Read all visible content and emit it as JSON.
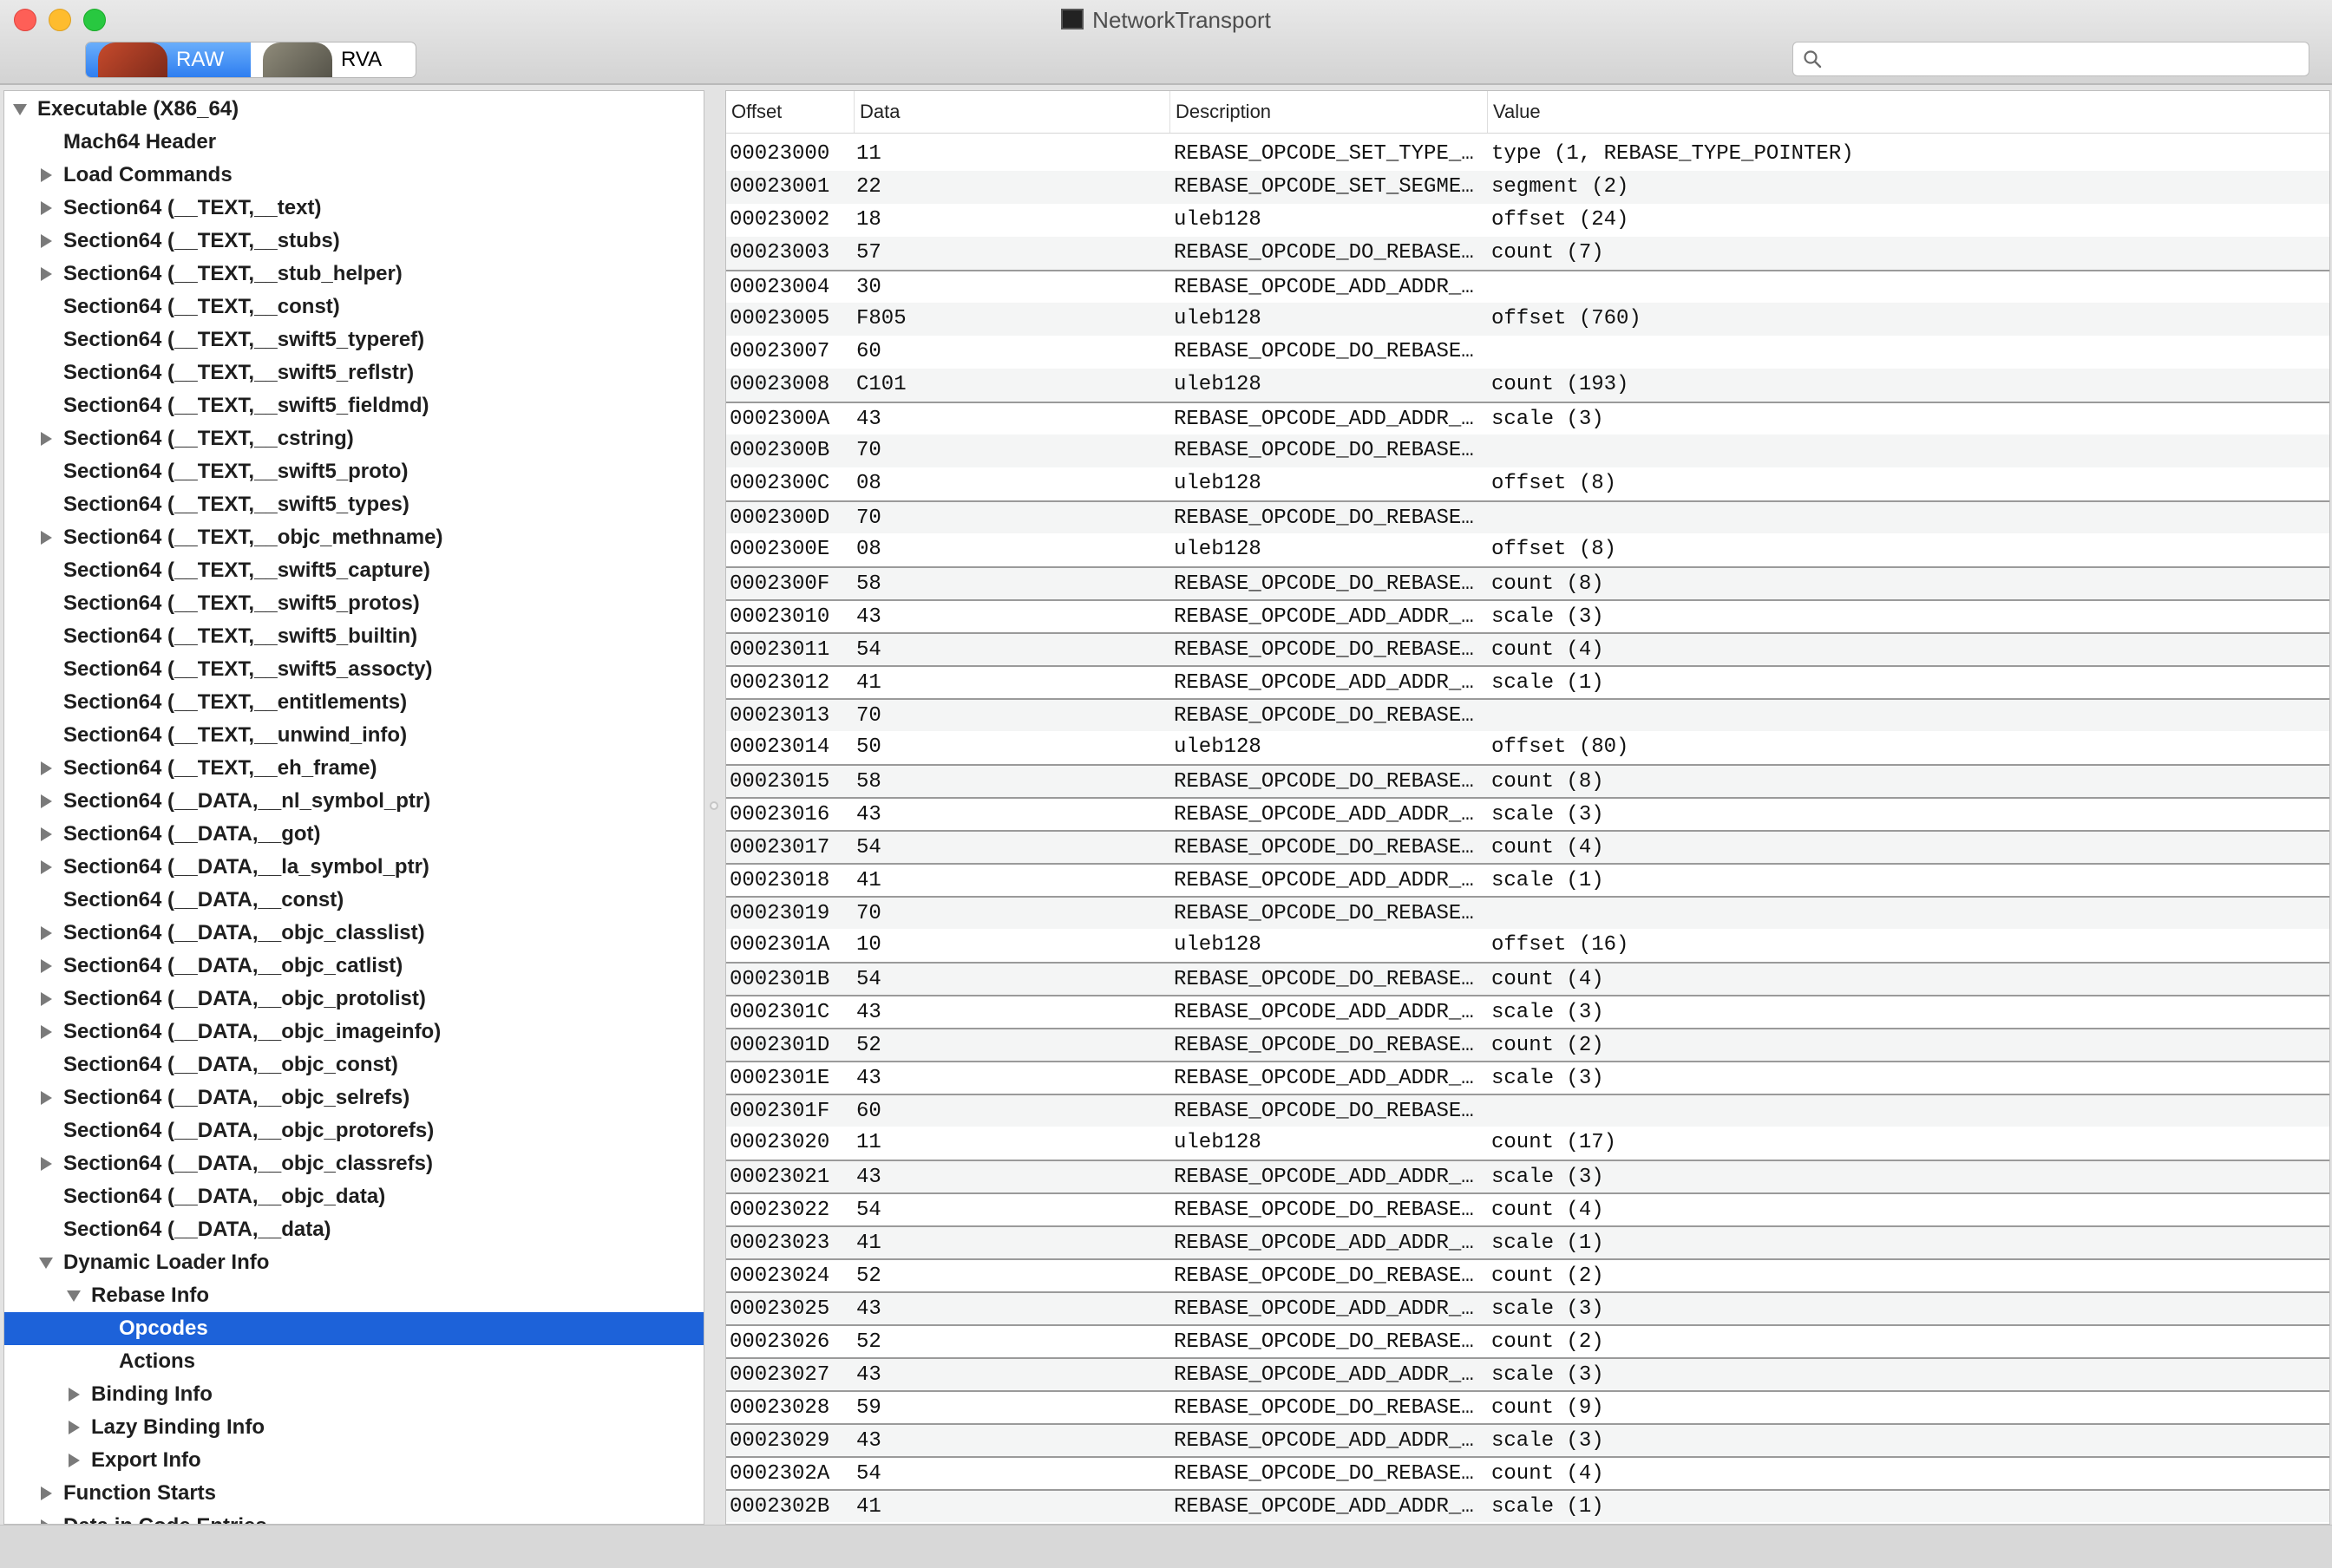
{
  "window": {
    "title": "NetworkTransport"
  },
  "toolbar": {
    "raw_label": "RAW",
    "rva_label": "RVA",
    "search_placeholder": "",
    "search_value": ""
  },
  "sidebar": {
    "items": [
      {
        "label": "Executable  (X86_64)",
        "indent": 0,
        "disclosure": "open",
        "selected": false
      },
      {
        "label": "Mach64 Header",
        "indent": 1,
        "disclosure": "none",
        "selected": false
      },
      {
        "label": "Load Commands",
        "indent": 1,
        "disclosure": "closed",
        "selected": false
      },
      {
        "label": "Section64 (__TEXT,__text)",
        "indent": 1,
        "disclosure": "closed",
        "selected": false
      },
      {
        "label": "Section64 (__TEXT,__stubs)",
        "indent": 1,
        "disclosure": "closed",
        "selected": false
      },
      {
        "label": "Section64 (__TEXT,__stub_helper)",
        "indent": 1,
        "disclosure": "closed",
        "selected": false
      },
      {
        "label": "Section64 (__TEXT,__const)",
        "indent": 1,
        "disclosure": "none",
        "selected": false
      },
      {
        "label": "Section64 (__TEXT,__swift5_typeref)",
        "indent": 1,
        "disclosure": "none",
        "selected": false
      },
      {
        "label": "Section64 (__TEXT,__swift5_reflstr)",
        "indent": 1,
        "disclosure": "none",
        "selected": false
      },
      {
        "label": "Section64 (__TEXT,__swift5_fieldmd)",
        "indent": 1,
        "disclosure": "none",
        "selected": false
      },
      {
        "label": "Section64 (__TEXT,__cstring)",
        "indent": 1,
        "disclosure": "closed",
        "selected": false
      },
      {
        "label": "Section64 (__TEXT,__swift5_proto)",
        "indent": 1,
        "disclosure": "none",
        "selected": false
      },
      {
        "label": "Section64 (__TEXT,__swift5_types)",
        "indent": 1,
        "disclosure": "none",
        "selected": false
      },
      {
        "label": "Section64 (__TEXT,__objc_methname)",
        "indent": 1,
        "disclosure": "closed",
        "selected": false
      },
      {
        "label": "Section64 (__TEXT,__swift5_capture)",
        "indent": 1,
        "disclosure": "none",
        "selected": false
      },
      {
        "label": "Section64 (__TEXT,__swift5_protos)",
        "indent": 1,
        "disclosure": "none",
        "selected": false
      },
      {
        "label": "Section64 (__TEXT,__swift5_builtin)",
        "indent": 1,
        "disclosure": "none",
        "selected": false
      },
      {
        "label": "Section64 (__TEXT,__swift5_assocty)",
        "indent": 1,
        "disclosure": "none",
        "selected": false
      },
      {
        "label": "Section64 (__TEXT,__entitlements)",
        "indent": 1,
        "disclosure": "none",
        "selected": false
      },
      {
        "label": "Section64 (__TEXT,__unwind_info)",
        "indent": 1,
        "disclosure": "none",
        "selected": false
      },
      {
        "label": "Section64 (__TEXT,__eh_frame)",
        "indent": 1,
        "disclosure": "closed",
        "selected": false
      },
      {
        "label": "Section64 (__DATA,__nl_symbol_ptr)",
        "indent": 1,
        "disclosure": "closed",
        "selected": false
      },
      {
        "label": "Section64 (__DATA,__got)",
        "indent": 1,
        "disclosure": "closed",
        "selected": false
      },
      {
        "label": "Section64 (__DATA,__la_symbol_ptr)",
        "indent": 1,
        "disclosure": "closed",
        "selected": false
      },
      {
        "label": "Section64 (__DATA,__const)",
        "indent": 1,
        "disclosure": "none",
        "selected": false
      },
      {
        "label": "Section64 (__DATA,__objc_classlist)",
        "indent": 1,
        "disclosure": "closed",
        "selected": false
      },
      {
        "label": "Section64 (__DATA,__objc_catlist)",
        "indent": 1,
        "disclosure": "closed",
        "selected": false
      },
      {
        "label": "Section64 (__DATA,__objc_protolist)",
        "indent": 1,
        "disclosure": "closed",
        "selected": false
      },
      {
        "label": "Section64 (__DATA,__objc_imageinfo)",
        "indent": 1,
        "disclosure": "closed",
        "selected": false
      },
      {
        "label": "Section64 (__DATA,__objc_const)",
        "indent": 1,
        "disclosure": "none",
        "selected": false
      },
      {
        "label": "Section64 (__DATA,__objc_selrefs)",
        "indent": 1,
        "disclosure": "closed",
        "selected": false
      },
      {
        "label": "Section64 (__DATA,__objc_protorefs)",
        "indent": 1,
        "disclosure": "none",
        "selected": false
      },
      {
        "label": "Section64 (__DATA,__objc_classrefs)",
        "indent": 1,
        "disclosure": "closed",
        "selected": false
      },
      {
        "label": "Section64 (__DATA,__objc_data)",
        "indent": 1,
        "disclosure": "none",
        "selected": false
      },
      {
        "label": "Section64 (__DATA,__data)",
        "indent": 1,
        "disclosure": "none",
        "selected": false
      },
      {
        "label": "Dynamic Loader Info",
        "indent": 1,
        "disclosure": "open",
        "selected": false
      },
      {
        "label": "Rebase Info",
        "indent": 2,
        "disclosure": "open",
        "selected": false
      },
      {
        "label": "Opcodes",
        "indent": 3,
        "disclosure": "none",
        "selected": true
      },
      {
        "label": "Actions",
        "indent": 3,
        "disclosure": "none",
        "selected": false
      },
      {
        "label": "Binding Info",
        "indent": 2,
        "disclosure": "closed",
        "selected": false
      },
      {
        "label": "Lazy Binding Info",
        "indent": 2,
        "disclosure": "closed",
        "selected": false
      },
      {
        "label": "Export Info",
        "indent": 2,
        "disclosure": "closed",
        "selected": false
      },
      {
        "label": "Function Starts",
        "indent": 1,
        "disclosure": "closed",
        "selected": false
      },
      {
        "label": "Data in Code Entries",
        "indent": 1,
        "disclosure": "closed",
        "selected": false
      }
    ]
  },
  "table": {
    "columns": [
      "Offset",
      "Data",
      "Description",
      "Value"
    ],
    "rows": [
      {
        "offset": "00023000",
        "data": "11",
        "description": "REBASE_OPCODE_SET_TYPE_IMM",
        "value": "type (1, REBASE_TYPE_POINTER)",
        "group_start": false
      },
      {
        "offset": "00023001",
        "data": "22",
        "description": "REBASE_OPCODE_SET_SEGMENT_AND_OFFSET_ULEB",
        "value": "segment (2)",
        "group_start": false
      },
      {
        "offset": "00023002",
        "data": "18",
        "description": "uleb128",
        "value": "offset (24)",
        "group_start": false
      },
      {
        "offset": "00023003",
        "data": "57",
        "description": "REBASE_OPCODE_DO_REBASE_IMM_TIMES",
        "value": "count (7)",
        "group_start": false
      },
      {
        "offset": "00023004",
        "data": "30",
        "description": "REBASE_OPCODE_ADD_ADDR_ULEB",
        "value": "",
        "group_start": true
      },
      {
        "offset": "00023005",
        "data": "F805",
        "description": "uleb128",
        "value": "offset (760)",
        "group_start": false
      },
      {
        "offset": "00023007",
        "data": "60",
        "description": "REBASE_OPCODE_DO_REBASE_ULEB_TIMES",
        "value": "",
        "group_start": false
      },
      {
        "offset": "00023008",
        "data": "C101",
        "description": "uleb128",
        "value": "count (193)",
        "group_start": false
      },
      {
        "offset": "0002300A",
        "data": "43",
        "description": "REBASE_OPCODE_ADD_ADDR_IMM_SCALED",
        "value": "scale (3)",
        "group_start": true
      },
      {
        "offset": "0002300B",
        "data": "70",
        "description": "REBASE_OPCODE_DO_REBASE_ADD_ADDR_ULEB",
        "value": "",
        "group_start": false
      },
      {
        "offset": "0002300C",
        "data": "08",
        "description": "uleb128",
        "value": "offset (8)",
        "group_start": false
      },
      {
        "offset": "0002300D",
        "data": "70",
        "description": "REBASE_OPCODE_DO_REBASE_ADD_ADDR_ULEB",
        "value": "",
        "group_start": true
      },
      {
        "offset": "0002300E",
        "data": "08",
        "description": "uleb128",
        "value": "offset (8)",
        "group_start": false
      },
      {
        "offset": "0002300F",
        "data": "58",
        "description": "REBASE_OPCODE_DO_REBASE_IMM_TIMES",
        "value": "count (8)",
        "group_start": true
      },
      {
        "offset": "00023010",
        "data": "43",
        "description": "REBASE_OPCODE_ADD_ADDR_IMM_SCALED",
        "value": "scale (3)",
        "group_start": true
      },
      {
        "offset": "00023011",
        "data": "54",
        "description": "REBASE_OPCODE_DO_REBASE_IMM_TIMES",
        "value": "count (4)",
        "group_start": true
      },
      {
        "offset": "00023012",
        "data": "41",
        "description": "REBASE_OPCODE_ADD_ADDR_IMM_SCALED",
        "value": "scale (1)",
        "group_start": true
      },
      {
        "offset": "00023013",
        "data": "70",
        "description": "REBASE_OPCODE_DO_REBASE_ADD_ADDR_ULEB",
        "value": "",
        "group_start": true
      },
      {
        "offset": "00023014",
        "data": "50",
        "description": "uleb128",
        "value": "offset (80)",
        "group_start": false
      },
      {
        "offset": "00023015",
        "data": "58",
        "description": "REBASE_OPCODE_DO_REBASE_IMM_TIMES",
        "value": "count (8)",
        "group_start": true
      },
      {
        "offset": "00023016",
        "data": "43",
        "description": "REBASE_OPCODE_ADD_ADDR_IMM_SCALED",
        "value": "scale (3)",
        "group_start": true
      },
      {
        "offset": "00023017",
        "data": "54",
        "description": "REBASE_OPCODE_DO_REBASE_IMM_TIMES",
        "value": "count (4)",
        "group_start": true
      },
      {
        "offset": "00023018",
        "data": "41",
        "description": "REBASE_OPCODE_ADD_ADDR_IMM_SCALED",
        "value": "scale (1)",
        "group_start": true
      },
      {
        "offset": "00023019",
        "data": "70",
        "description": "REBASE_OPCODE_DO_REBASE_ADD_ADDR_ULEB",
        "value": "",
        "group_start": true
      },
      {
        "offset": "0002301A",
        "data": "10",
        "description": "uleb128",
        "value": "offset (16)",
        "group_start": false
      },
      {
        "offset": "0002301B",
        "data": "54",
        "description": "REBASE_OPCODE_DO_REBASE_IMM_TIMES",
        "value": "count (4)",
        "group_start": true
      },
      {
        "offset": "0002301C",
        "data": "43",
        "description": "REBASE_OPCODE_ADD_ADDR_IMM_SCALED",
        "value": "scale (3)",
        "group_start": true
      },
      {
        "offset": "0002301D",
        "data": "52",
        "description": "REBASE_OPCODE_DO_REBASE_IMM_TIMES",
        "value": "count (2)",
        "group_start": true
      },
      {
        "offset": "0002301E",
        "data": "43",
        "description": "REBASE_OPCODE_ADD_ADDR_IMM_SCALED",
        "value": "scale (3)",
        "group_start": true
      },
      {
        "offset": "0002301F",
        "data": "60",
        "description": "REBASE_OPCODE_DO_REBASE_ULEB_TIMES",
        "value": "",
        "group_start": true
      },
      {
        "offset": "00023020",
        "data": "11",
        "description": "uleb128",
        "value": "count (17)",
        "group_start": false
      },
      {
        "offset": "00023021",
        "data": "43",
        "description": "REBASE_OPCODE_ADD_ADDR_IMM_SCALED",
        "value": "scale (3)",
        "group_start": true
      },
      {
        "offset": "00023022",
        "data": "54",
        "description": "REBASE_OPCODE_DO_REBASE_IMM_TIMES",
        "value": "count (4)",
        "group_start": true
      },
      {
        "offset": "00023023",
        "data": "41",
        "description": "REBASE_OPCODE_ADD_ADDR_IMM_SCALED",
        "value": "scale (1)",
        "group_start": true
      },
      {
        "offset": "00023024",
        "data": "52",
        "description": "REBASE_OPCODE_DO_REBASE_IMM_TIMES",
        "value": "count (2)",
        "group_start": true
      },
      {
        "offset": "00023025",
        "data": "43",
        "description": "REBASE_OPCODE_ADD_ADDR_IMM_SCALED",
        "value": "scale (3)",
        "group_start": true
      },
      {
        "offset": "00023026",
        "data": "52",
        "description": "REBASE_OPCODE_DO_REBASE_IMM_TIMES",
        "value": "count (2)",
        "group_start": true
      },
      {
        "offset": "00023027",
        "data": "43",
        "description": "REBASE_OPCODE_ADD_ADDR_IMM_SCALED",
        "value": "scale (3)",
        "group_start": true
      },
      {
        "offset": "00023028",
        "data": "59",
        "description": "REBASE_OPCODE_DO_REBASE_IMM_TIMES",
        "value": "count (9)",
        "group_start": true
      },
      {
        "offset": "00023029",
        "data": "43",
        "description": "REBASE_OPCODE_ADD_ADDR_IMM_SCALED",
        "value": "scale (3)",
        "group_start": true
      },
      {
        "offset": "0002302A",
        "data": "54",
        "description": "REBASE_OPCODE_DO_REBASE_IMM_TIMES",
        "value": "count (4)",
        "group_start": true
      },
      {
        "offset": "0002302B",
        "data": "41",
        "description": "REBASE_OPCODE_ADD_ADDR_IMM_SCALED",
        "value": "scale (1)",
        "group_start": true
      }
    ]
  },
  "colors": {
    "selection": "#1d62d9",
    "segment_active": "#2e7ef0",
    "close": "#fe5f57",
    "minimize": "#febc2e",
    "maximize": "#28c840"
  },
  "icons": {
    "search": "search-icon",
    "window": "terminal-window-icon"
  }
}
